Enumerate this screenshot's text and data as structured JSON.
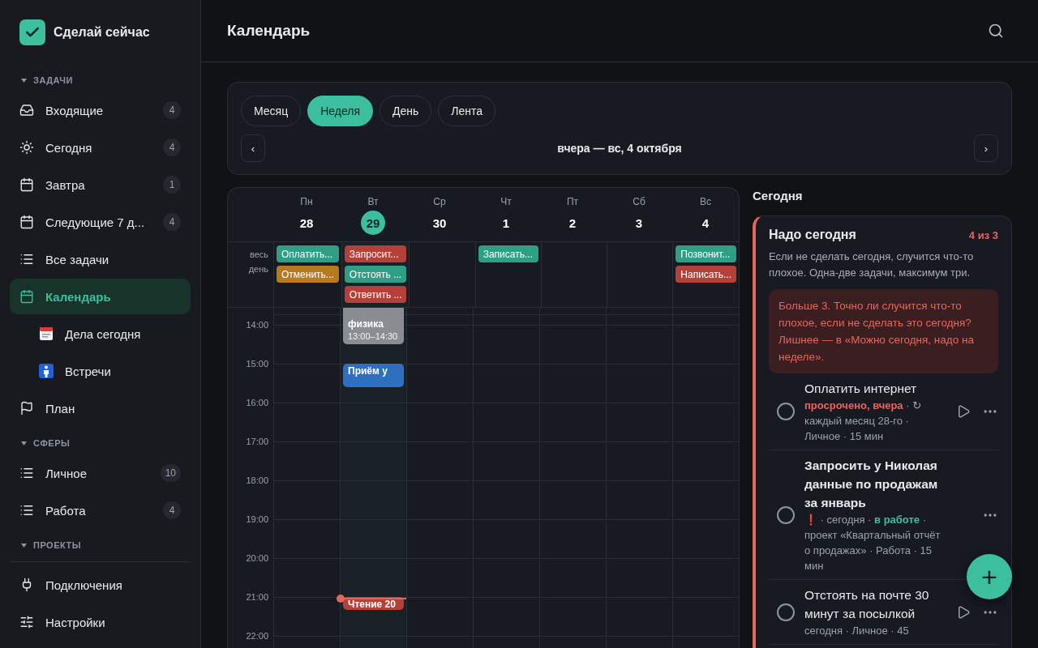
{
  "app": {
    "name": "Сделай сейчас"
  },
  "sidebar": {
    "sections": [
      {
        "title": "ЗАДАЧИ",
        "expanded": true,
        "items": [
          {
            "label": "Входящие",
            "kind": "inbox",
            "count": "4",
            "selected": false
          },
          {
            "label": "Сегодня",
            "kind": "sun",
            "count": "4",
            "selected": false
          },
          {
            "label": "Завтра",
            "kind": "calendar",
            "count": "1",
            "selected": false
          },
          {
            "label": "Следующие 7 д...",
            "kind": "calendar",
            "count": "4",
            "selected": false
          },
          {
            "label": "Все задачи",
            "kind": "list",
            "selected": false
          },
          {
            "label": "Календарь",
            "kind": "calendar",
            "selected": true
          },
          {
            "label": "Дела сегодня",
            "kind": "tearoff",
            "sub": true,
            "selected": false
          },
          {
            "label": "Встречи",
            "kind": "person",
            "sub": true,
            "selected": false
          },
          {
            "label": "План",
            "kind": "flag",
            "selected": false
          }
        ]
      },
      {
        "title": "СФЕРЫ",
        "expanded": true,
        "items": [
          {
            "label": "Личное",
            "kind": "list",
            "count": "10",
            "selected": false
          },
          {
            "label": "Работа",
            "kind": "list",
            "count": "4",
            "selected": false
          }
        ]
      },
      {
        "title": "ПРОЕКТЫ",
        "expanded": true
      }
    ],
    "bottom": [
      {
        "label": "Подключения",
        "kind": "plug"
      },
      {
        "label": "Настройки",
        "kind": "sliders"
      }
    ]
  },
  "header": {
    "title": "Календарь"
  },
  "views": [
    {
      "label": "Месяц",
      "selected": false
    },
    {
      "label": "Неделя",
      "selected": true
    },
    {
      "label": "День",
      "selected": false
    },
    {
      "label": "Лента",
      "selected": false
    }
  ],
  "range": {
    "prev": "‹",
    "label": "вчера — вс, 4 октября",
    "next": "›"
  },
  "calendar": {
    "all_day_label": "весь день",
    "hours": [
      "14:00",
      "15:00",
      "16:00",
      "17:00",
      "18:00",
      "19:00",
      "20:00",
      "21:00",
      "22:00"
    ],
    "days": [
      {
        "weekday": "Пн",
        "date": "28",
        "today": false,
        "all_day": [
          {
            "title": "Оплатить...",
            "color": "#2e9e84"
          },
          {
            "title": "Отменить...",
            "color": "#b87a1f"
          }
        ]
      },
      {
        "weekday": "Вт",
        "date": "29",
        "today": true,
        "all_day": [
          {
            "title": "Запросит...",
            "color": "#b5403a"
          },
          {
            "title": "Отстоять ...",
            "color": "#2e9e84"
          },
          {
            "title": "Ответить ...",
            "color": "#b5403a"
          }
        ],
        "events": [
          {
            "title": "физика",
            "time": "13:00–14:30",
            "color": "#8a8d92"
          },
          {
            "title": "Приём у",
            "color": "#2f6fbf"
          },
          {
            "title": "Чтение 20",
            "color": "#b5403a"
          }
        ]
      },
      {
        "weekday": "Ср",
        "date": "30",
        "today": false
      },
      {
        "weekday": "Чт",
        "date": "1",
        "today": false,
        "all_day": [
          {
            "title": "Записать...",
            "color": "#2e9e84"
          }
        ]
      },
      {
        "weekday": "Пт",
        "date": "2",
        "today": false
      },
      {
        "weekday": "Сб",
        "date": "3",
        "today": false
      },
      {
        "weekday": "Вс",
        "date": "4",
        "today": false,
        "all_day": [
          {
            "title": "Позвонит...",
            "color": "#2e9e84"
          },
          {
            "title": "Написать...",
            "color": "#b5403a"
          }
        ]
      }
    ]
  },
  "today_panel": {
    "title": "Сегодня",
    "group": {
      "title": "Надо сегодня",
      "count": "4 из 3",
      "over_limit": true,
      "description": "Если не сделать сегодня, случится что-то плохое. Одна-две задачи, максимум три.",
      "warning": "Больше 3. Точно ли случится что-то плохое, если не сделать это сегодня? Лишнее — в «Можно сегодня, надо на неделе».",
      "tasks": [
        {
          "title": "Оплатить интернет",
          "bold": false,
          "play": true,
          "done": false,
          "meta": [
            {
              "kind": "overdue",
              "text": "просрочено, вчера"
            },
            {
              "kind": "plain",
              "text": " · ↻ каждый месяц 28-го · Личное · 15 мин"
            }
          ]
        },
        {
          "title": "Запросить у Николая данные по продажам за январь",
          "bold": true,
          "play": false,
          "done": false,
          "meta": [
            {
              "kind": "priority",
              "text": "❗"
            },
            {
              "kind": "plain",
              "text": " · сегодня · "
            },
            {
              "kind": "status",
              "text": "в работе"
            },
            {
              "kind": "plain",
              "text": " · проект «Квартальный отчёт о продажах» · Работа · 15 мин"
            }
          ]
        },
        {
          "title": "Отстоять на почте 30 минут за посылкой",
          "bold": false,
          "play": true,
          "done": false,
          "meta": [
            {
              "kind": "plain",
              "text": "сегодня · Личное · 45"
            }
          ]
        }
      ]
    }
  },
  "fab": {
    "label": "+"
  }
}
